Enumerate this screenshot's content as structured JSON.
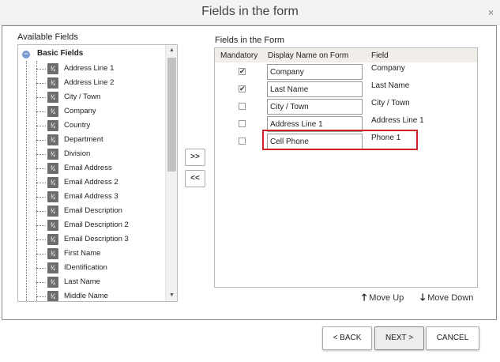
{
  "dialog": {
    "title": "Fields in the form",
    "close_label": "×"
  },
  "available": {
    "label": "Available Fields",
    "root_label": "Basic Fields",
    "root_toggle": "−",
    "icon_glyph": "¼",
    "items": [
      {
        "label": "Address Line 1"
      },
      {
        "label": "Address Line 2"
      },
      {
        "label": "City / Town"
      },
      {
        "label": "Company"
      },
      {
        "label": "Country"
      },
      {
        "label": "Department"
      },
      {
        "label": "Division"
      },
      {
        "label": "Email Address"
      },
      {
        "label": "Email Address 2"
      },
      {
        "label": "Email Address 3"
      },
      {
        "label": "Email Description"
      },
      {
        "label": "Email Description 2"
      },
      {
        "label": "Email Description 3"
      },
      {
        "label": "First Name"
      },
      {
        "label": "IDentification"
      },
      {
        "label": "Last Name"
      },
      {
        "label": "Middle Name"
      }
    ]
  },
  "move_buttons": {
    "add": ">>",
    "remove": "<<"
  },
  "form_fields": {
    "label": "Fields in the Form",
    "columns": {
      "mandatory": "Mandatory",
      "display_name": "Display Name on Form",
      "field": "Field"
    },
    "rows": [
      {
        "mandatory": true,
        "display_name": "Company",
        "field": "Company"
      },
      {
        "mandatory": true,
        "display_name": "Last Name",
        "field": "Last Name"
      },
      {
        "mandatory": false,
        "display_name": "City / Town",
        "field": "City / Town"
      },
      {
        "mandatory": false,
        "display_name": "Address Line 1",
        "field": "Address Line 1"
      },
      {
        "mandatory": false,
        "display_name": "Cell Phone",
        "field": "Phone 1"
      }
    ],
    "highlight_color": "#d0202a"
  },
  "reorder": {
    "move_up": "Move Up",
    "move_down": "Move Down"
  },
  "footer": {
    "back": "< BACK",
    "next": "NEXT >",
    "cancel": "CANCEL"
  }
}
